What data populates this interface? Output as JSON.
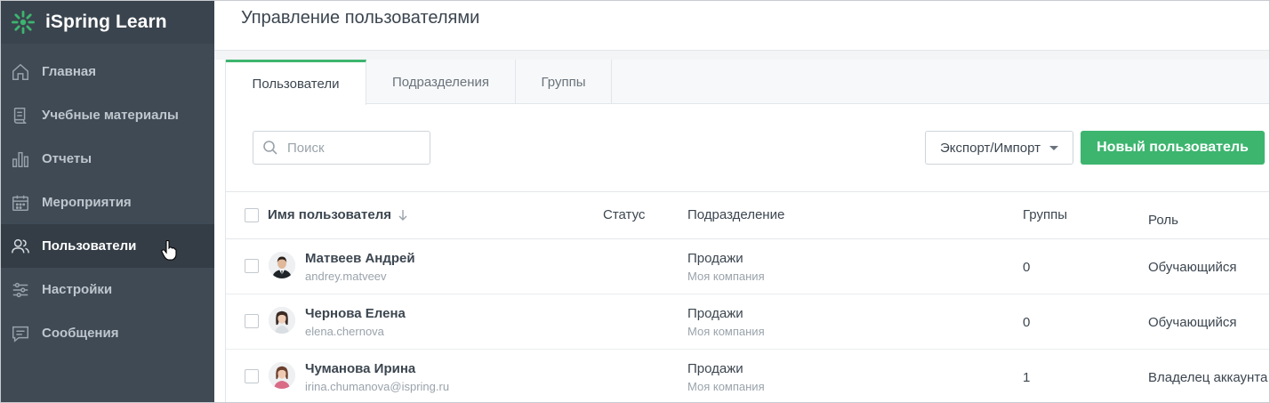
{
  "brand": {
    "name": "iSpring Learn",
    "accent": "#3db56f"
  },
  "sidebar": {
    "items": [
      {
        "label": "Главная",
        "icon": "home-icon"
      },
      {
        "label": "Учебные материалы",
        "icon": "materials-icon"
      },
      {
        "label": "Отчеты",
        "icon": "reports-icon"
      },
      {
        "label": "Мероприятия",
        "icon": "calendar-icon"
      },
      {
        "label": "Пользователи",
        "icon": "users-icon",
        "active": true
      },
      {
        "label": "Настройки",
        "icon": "settings-sliders-icon"
      },
      {
        "label": "Сообщения",
        "icon": "messages-icon"
      }
    ]
  },
  "header": {
    "title": "Управление пользователями"
  },
  "tabs": [
    {
      "label": "Пользователи",
      "active": true
    },
    {
      "label": "Подразделения"
    },
    {
      "label": "Группы"
    }
  ],
  "toolbar": {
    "search_placeholder": "Поиск",
    "export_label": "Экспорт/Импорт",
    "new_user_label": "Новый пользователь"
  },
  "table": {
    "columns": {
      "name": "Имя пользователя",
      "status": "Статус",
      "department": "Подразделение",
      "groups": "Группы",
      "role": "Роль"
    },
    "rows": [
      {
        "name": "Матвеев Андрей",
        "login": "andrey.matveev",
        "status": "",
        "department": "Продажи",
        "company": "Моя компания",
        "groups": "0",
        "role": "Обучающийся"
      },
      {
        "name": "Чернова Елена",
        "login": "elena.chernova",
        "status": "",
        "department": "Продажи",
        "company": "Моя компания",
        "groups": "0",
        "role": "Обучающийся"
      },
      {
        "name": "Чуманова Ирина",
        "login": "irina.chumanova@ispring.ru",
        "status": "",
        "department": "Продажи",
        "company": "Моя компания",
        "groups": "1",
        "role": "Владелец аккаунта"
      }
    ]
  }
}
